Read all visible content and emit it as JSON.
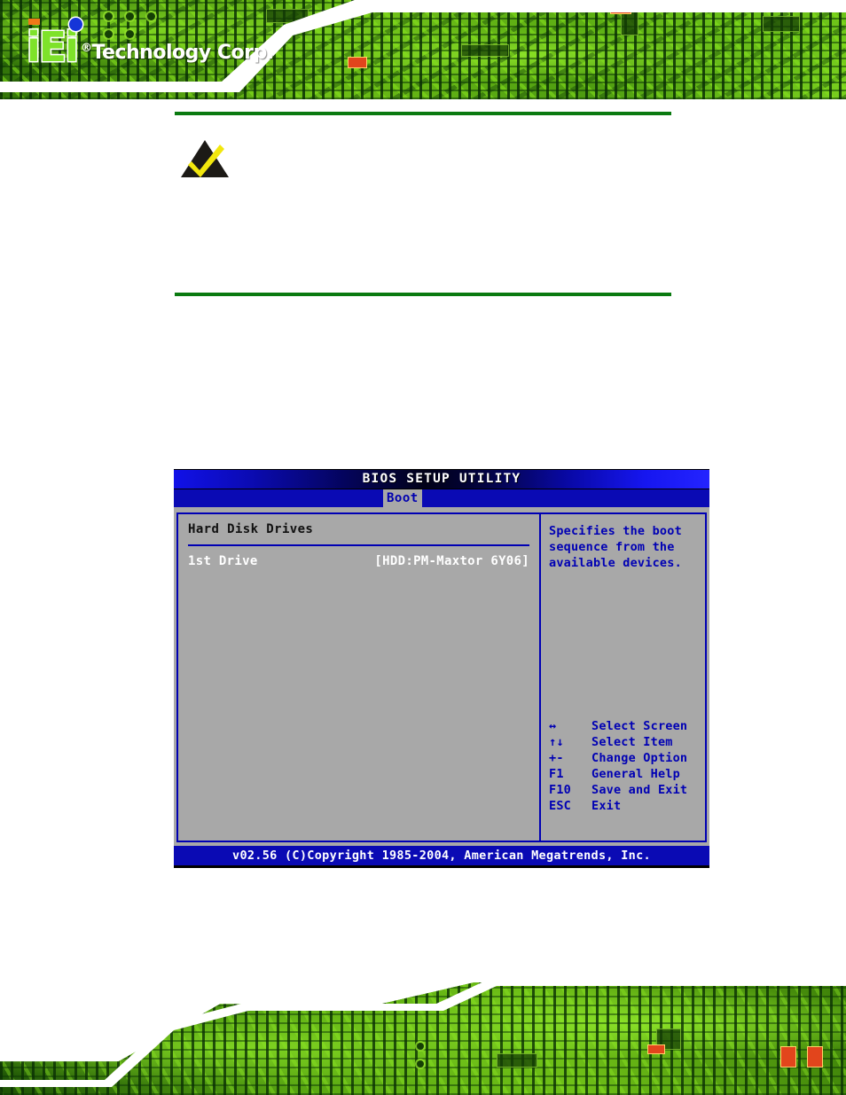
{
  "header": {
    "logo_primary": "iEi",
    "logo_secondary": "Technology Corp.",
    "logo_registered": "®"
  },
  "note": {
    "icon_name": "note-triangle-check-icon",
    "body_text": ""
  },
  "bios": {
    "title": "BIOS SETUP UTILITY",
    "active_tab": "Boot",
    "left_panel": {
      "section_title": "Hard Disk Drives",
      "rows": [
        {
          "label": "1st Drive",
          "value": "[HDD:PM-Maxtor 6Y06]"
        }
      ]
    },
    "right_panel": {
      "help_text": "Specifies the boot sequence from the available devices.",
      "keys": [
        {
          "key": "↔",
          "desc": "Select Screen"
        },
        {
          "key": "↑↓",
          "desc": "Select Item"
        },
        {
          "key": "+-",
          "desc": "Change Option"
        },
        {
          "key": "F1",
          "desc": "General Help"
        },
        {
          "key": "F10",
          "desc": "Save and Exit"
        },
        {
          "key": "ESC",
          "desc": "Exit"
        }
      ]
    },
    "footer": "v02.56 (C)Copyright 1985-2004, American Megatrends, Inc."
  },
  "colors": {
    "bios_blue": "#0000b4",
    "bios_gray": "#a8a8a8",
    "menubar_blue": "#0a0ab4",
    "brand_green": "#7ee22a",
    "rule_green": "#0a7a10",
    "note_check_yellow": "#f2e70d"
  }
}
